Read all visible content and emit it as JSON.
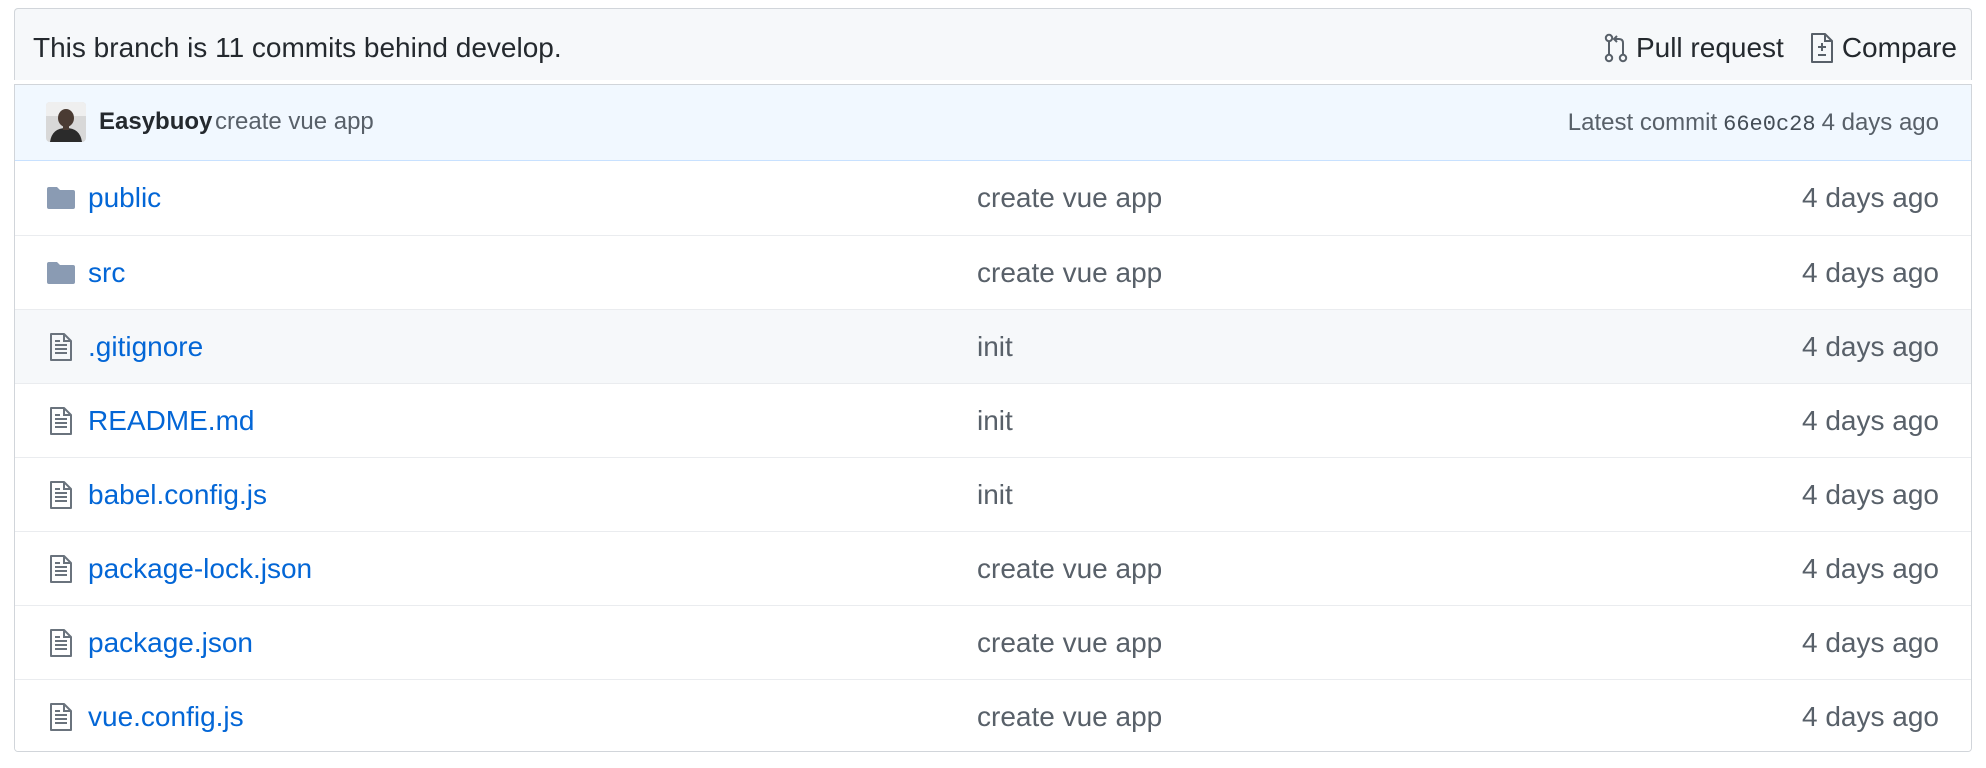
{
  "branch_bar": {
    "status_text": "This branch is 11 commits behind develop.",
    "pull_request_label": "Pull request",
    "compare_label": "Compare"
  },
  "latest_commit": {
    "author": "Easybuoy",
    "message": "create vue app",
    "prefix": "Latest commit",
    "sha": "66e0c28",
    "age": "4 days ago"
  },
  "files": [
    {
      "type": "folder",
      "icon": "folder-icon",
      "name": "public",
      "message": "create vue app",
      "age": "4 days ago"
    },
    {
      "type": "folder",
      "icon": "folder-icon",
      "name": "src",
      "message": "create vue app",
      "age": "4 days ago"
    },
    {
      "type": "file",
      "icon": "file-icon",
      "name": ".gitignore",
      "message": "init",
      "age": "4 days ago"
    },
    {
      "type": "file",
      "icon": "file-icon",
      "name": "README.md",
      "message": "init",
      "age": "4 days ago"
    },
    {
      "type": "file",
      "icon": "file-icon",
      "name": "babel.config.js",
      "message": "init",
      "age": "4 days ago"
    },
    {
      "type": "file",
      "icon": "file-icon",
      "name": "package-lock.json",
      "message": "create vue app",
      "age": "4 days ago"
    },
    {
      "type": "file",
      "icon": "file-icon",
      "name": "package.json",
      "message": "create vue app",
      "age": "4 days ago"
    },
    {
      "type": "file",
      "icon": "file-icon",
      "name": "vue.config.js",
      "message": "create vue app",
      "age": "4 days ago"
    }
  ],
  "colors": {
    "link": "#0366d6",
    "muted": "#586069",
    "commit_bar_bg": "#f1f8ff",
    "folder_icon": "#79b8ff",
    "hovered_row_bg": "#f6f8fa"
  }
}
